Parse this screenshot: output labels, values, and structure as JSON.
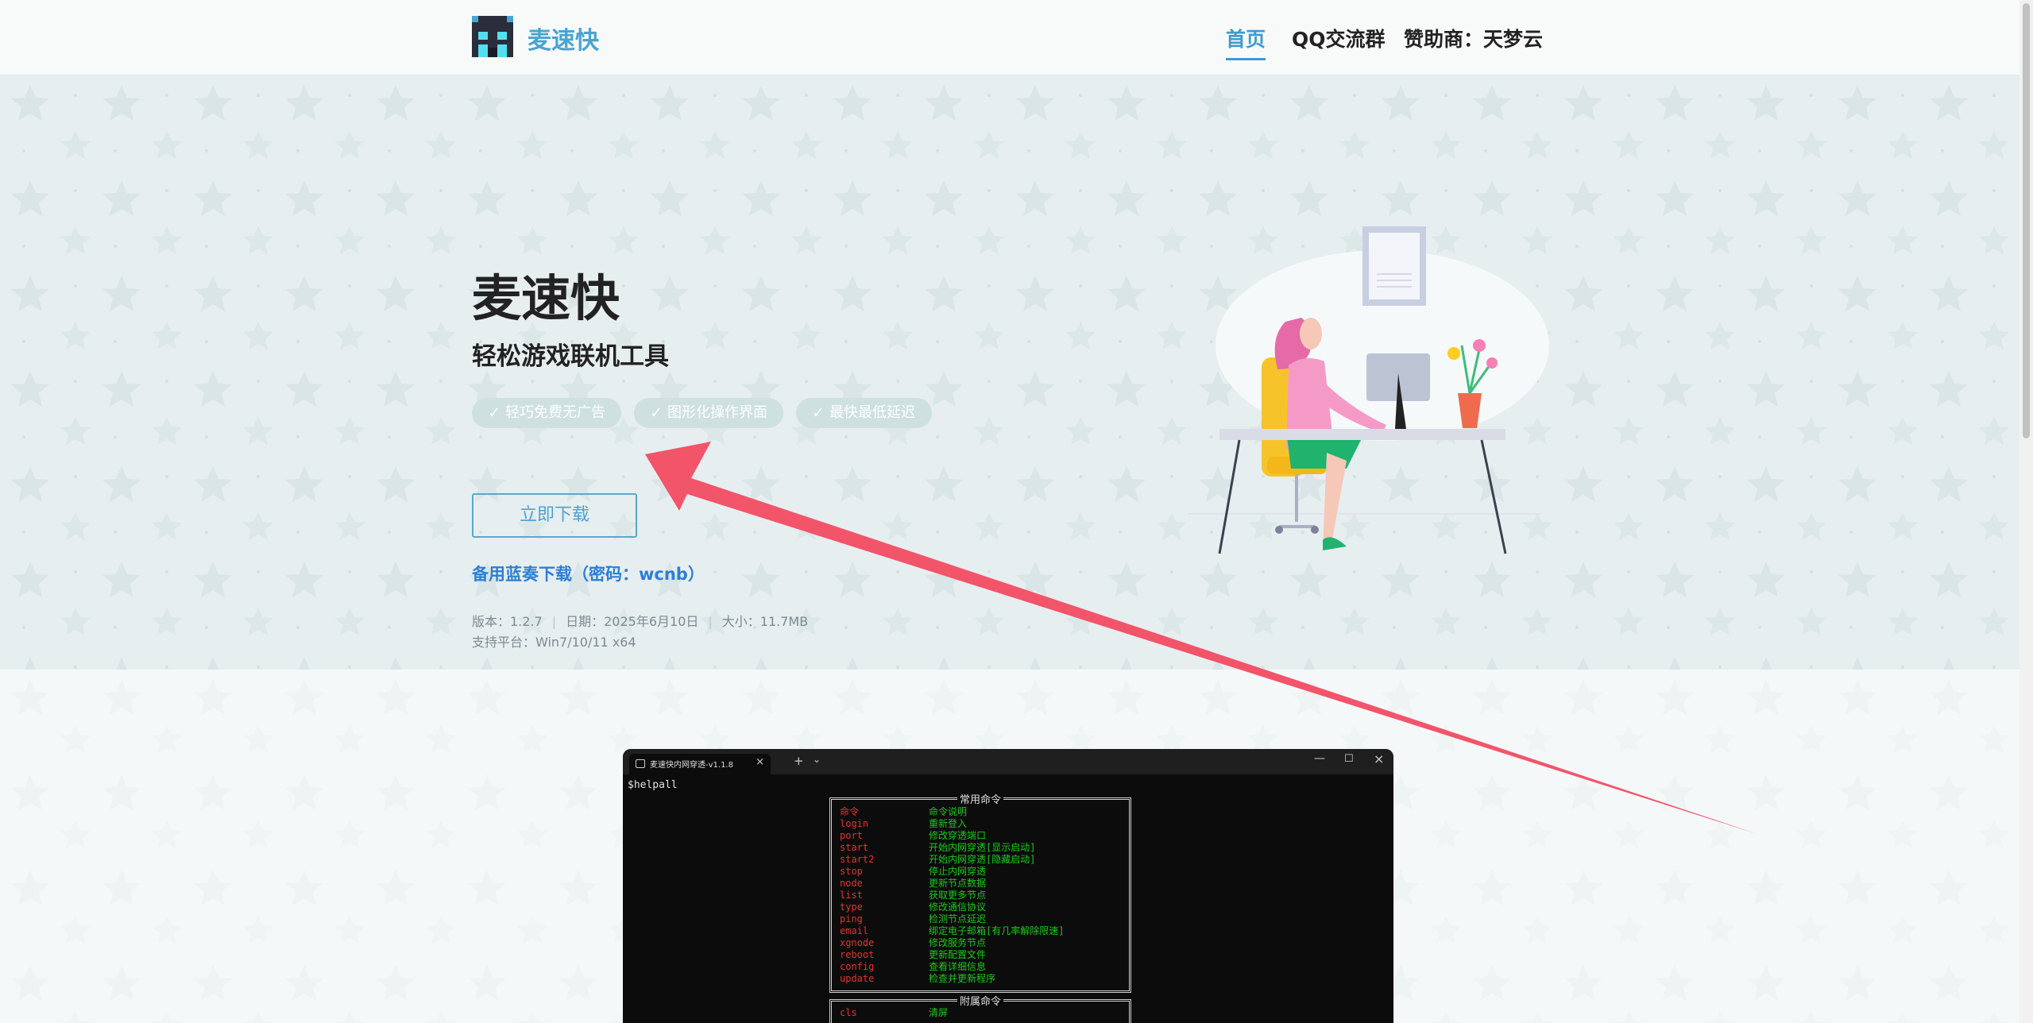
{
  "header": {
    "brand": "麦速快",
    "nav": [
      {
        "label": "首页",
        "active": true
      },
      {
        "label": "QQ交流群"
      },
      {
        "label": "赞助商：天梦云"
      }
    ]
  },
  "hero": {
    "title": "麦速快",
    "subtitle": "轻松游戏联机工具",
    "tags": [
      "轻巧免费无广告",
      "图形化操作界面",
      "最快最低延迟"
    ],
    "download_label": "立即下载",
    "backup_link": "备用蓝奏下载（密码：wcnb）",
    "meta": {
      "version": "版本：1.2.7",
      "date": "日期：2025年6月10日",
      "size": "大小：11.7MB",
      "platform": "支持平台：Win7/10/11 x64"
    }
  },
  "terminal": {
    "tab_title": "麦速快内网穿透-v1.1.8",
    "prompt": "$helpall",
    "box1_title": "常用命令",
    "commands": [
      {
        "name": "命令",
        "desc": "命令说明"
      },
      {
        "name": "login",
        "desc": "重新登入"
      },
      {
        "name": "port",
        "desc": "修改穿透端口"
      },
      {
        "name": "start",
        "desc": "开始内网穿透[显示启动]"
      },
      {
        "name": "start2",
        "desc": "开始内网穿透[隐藏启动]"
      },
      {
        "name": "stop",
        "desc": "停止内网穿透"
      },
      {
        "name": "node",
        "desc": "更新节点数据"
      },
      {
        "name": "list",
        "desc": "获取更多节点"
      },
      {
        "name": "type",
        "desc": "修改通信协议"
      },
      {
        "name": "ping",
        "desc": "检测节点延迟"
      },
      {
        "name": "email",
        "desc": "绑定电子邮箱[有几率解除限速]"
      },
      {
        "name": "xgnode",
        "desc": "修改服务节点"
      },
      {
        "name": "reboot",
        "desc": "更新配置文件"
      },
      {
        "name": "config",
        "desc": "查看详细信息"
      },
      {
        "name": "update",
        "desc": "检查并更新程序"
      }
    ],
    "box2_title": "附属命令",
    "commands2": [
      {
        "name": "cls",
        "desc": "清屏"
      }
    ]
  },
  "colors": {
    "accent": "#4aa3d3",
    "link": "#2b7fd4",
    "arrow": "#f2546a",
    "terminal_cmd": "#e5322f",
    "terminal_desc": "#1bc91b"
  }
}
